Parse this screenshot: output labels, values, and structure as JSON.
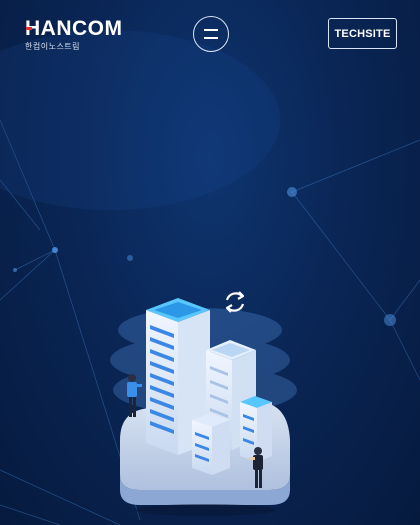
{
  "header": {
    "logo_text": "HANCOM",
    "logo_subtext": "한컴이노스트림",
    "menu_icon": "hamburger-icon",
    "techsite_label": "TECHSITE"
  },
  "illustration": {
    "subject": "cloud-server-illustration",
    "sync_icon": "sync-icon"
  },
  "colors": {
    "background": "#0a2656",
    "accent_red": "#e8322f",
    "server_blue": "#2f7de0",
    "server_white": "#e8f0fb"
  }
}
